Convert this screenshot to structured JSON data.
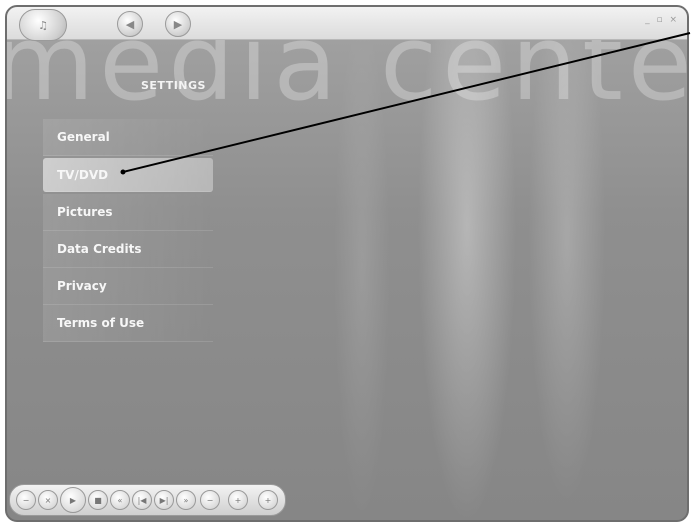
{
  "window": {
    "watermark_text": "media cente"
  },
  "topbar": {
    "start_icon": "media-center-start-icon",
    "back_icon": "back-arrow-icon",
    "forward_icon": "forward-icon",
    "window_controls": "_ ▫ ×"
  },
  "settings": {
    "title": "SETTINGS",
    "items": [
      {
        "label": "General"
      },
      {
        "label": "TV/DVD",
        "selected": true
      },
      {
        "label": "Pictures"
      },
      {
        "label": "Data Credits"
      },
      {
        "label": "Privacy"
      },
      {
        "label": "Terms of Use"
      }
    ]
  },
  "transport": {
    "buttons": [
      "volume-down-icon",
      "mute-icon",
      "play-icon",
      "stop-icon",
      "rewind-icon",
      "previous-icon",
      "next-icon",
      "fast-forward-icon",
      "channel-down-icon",
      "channel-up-icon",
      "volume-up-icon"
    ]
  },
  "colors": {
    "background": "#8f8f8f",
    "highlight": "#ffffff",
    "callout_line": "#000000"
  }
}
